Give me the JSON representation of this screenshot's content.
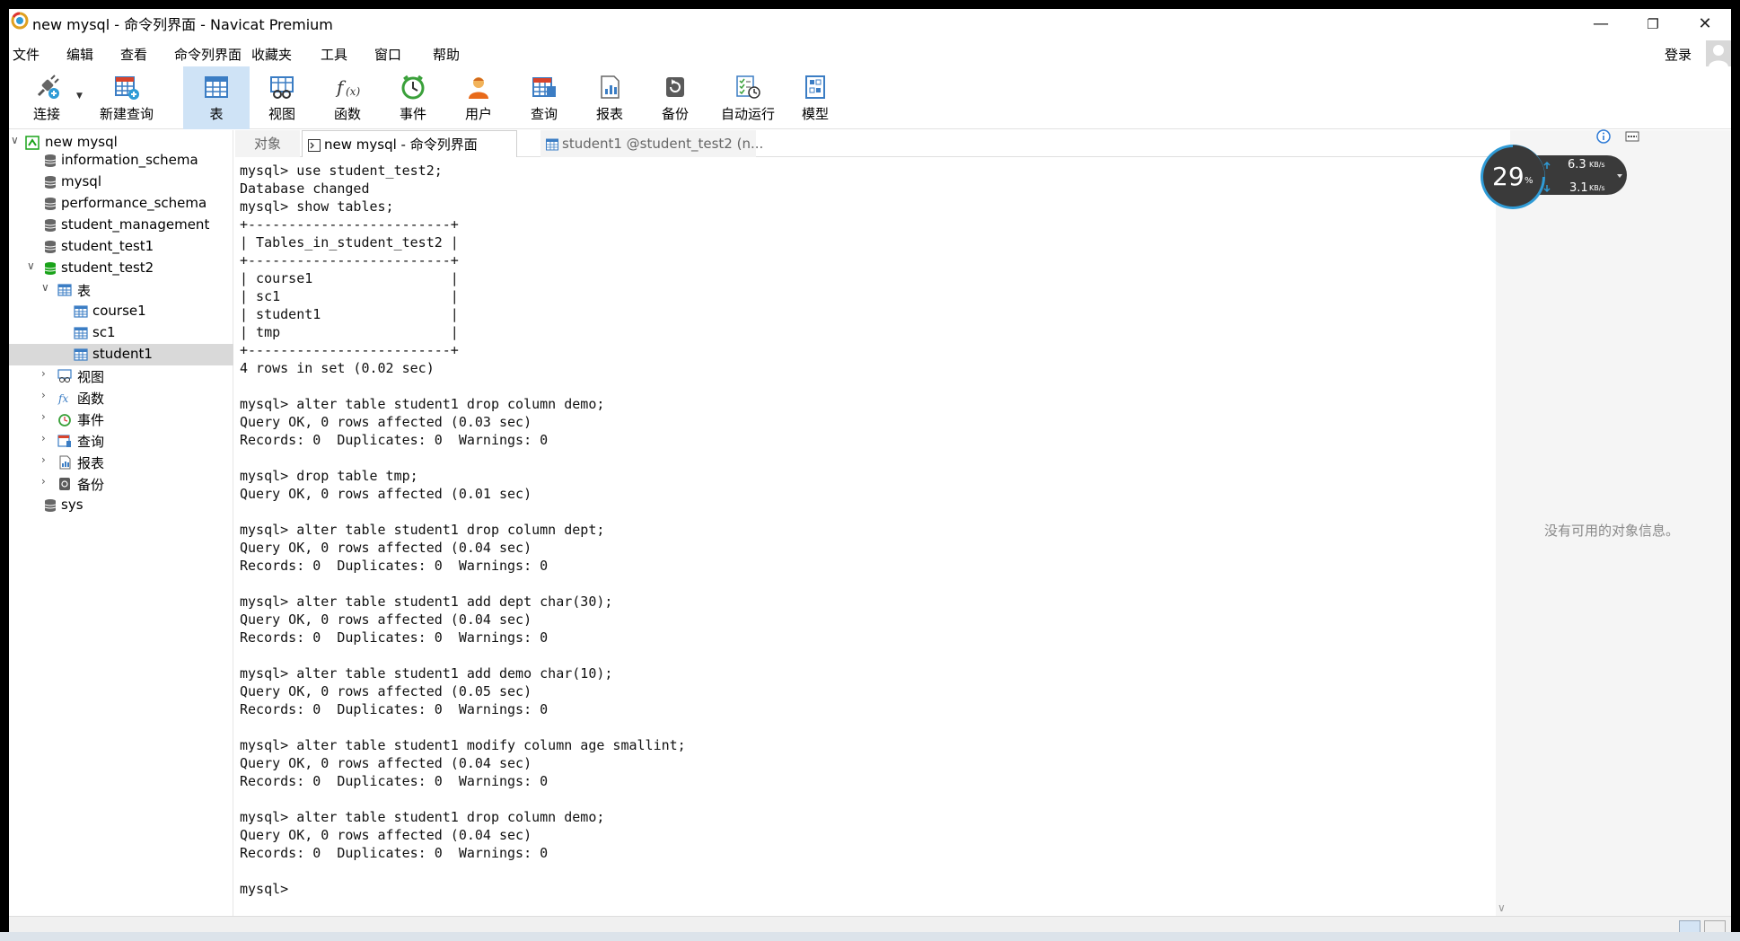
{
  "window": {
    "title": "new mysql - 命令列界面 - Navicat Premium",
    "minimize": "—",
    "restore": "❐",
    "close": "✕"
  },
  "menu": {
    "items": [
      "文件",
      "编辑",
      "查看",
      "命令列界面",
      "收藏夹",
      "工具",
      "窗口",
      "帮助"
    ],
    "login": "登录"
  },
  "toolbar": {
    "buttons": [
      {
        "label": "连接",
        "icon": "connection-icon"
      },
      {
        "label": "新建查询",
        "icon": "new-query-icon"
      },
      {
        "label": "表",
        "icon": "table-icon"
      },
      {
        "label": "视图",
        "icon": "view-icon"
      },
      {
        "label": "函数",
        "icon": "function-icon"
      },
      {
        "label": "事件",
        "icon": "event-icon"
      },
      {
        "label": "用户",
        "icon": "user-icon"
      },
      {
        "label": "查询",
        "icon": "query-icon"
      },
      {
        "label": "报表",
        "icon": "report-icon"
      },
      {
        "label": "备份",
        "icon": "backup-icon"
      },
      {
        "label": "自动运行",
        "icon": "automation-icon"
      },
      {
        "label": "模型",
        "icon": "model-icon"
      }
    ]
  },
  "navigator": {
    "items": [
      {
        "label": "new mysql",
        "icon": "connection-icon",
        "level": 0,
        "expanded": true
      },
      {
        "label": "information_schema",
        "icon": "database-icon",
        "level": 1
      },
      {
        "label": "mysql",
        "icon": "database-icon",
        "level": 1
      },
      {
        "label": "performance_schema",
        "icon": "database-icon",
        "level": 1
      },
      {
        "label": "student_management",
        "icon": "database-icon",
        "level": 1
      },
      {
        "label": "student_test1",
        "icon": "database-icon",
        "level": 1
      },
      {
        "label": "student_test2",
        "icon": "database-open-icon",
        "level": 1,
        "expanded": true
      },
      {
        "label": "表",
        "icon": "table-icon",
        "level": 2,
        "expanded": true
      },
      {
        "label": "course1",
        "icon": "table-icon",
        "level": 3
      },
      {
        "label": "sc1",
        "icon": "table-icon",
        "level": 3
      },
      {
        "label": "student1",
        "icon": "table-icon",
        "level": 3,
        "selected": true
      },
      {
        "label": "视图",
        "icon": "view-icon",
        "level": 2,
        "collapsed": true
      },
      {
        "label": "函数",
        "icon": "function-icon",
        "level": 2,
        "collapsed": true
      },
      {
        "label": "事件",
        "icon": "event-icon",
        "level": 2,
        "collapsed": true
      },
      {
        "label": "查询",
        "icon": "query-icon",
        "level": 2,
        "collapsed": true
      },
      {
        "label": "报表",
        "icon": "report-icon",
        "level": 2,
        "collapsed": true
      },
      {
        "label": "备份",
        "icon": "backup-icon",
        "level": 2,
        "collapsed": true
      },
      {
        "label": "sys",
        "icon": "database-icon",
        "level": 1
      }
    ]
  },
  "tabs": [
    {
      "label": "对象",
      "state": "inactive"
    },
    {
      "label": "new mysql - 命令列界面",
      "state": "active"
    },
    {
      "label": "student1 @student_test2 (n...",
      "state": "inactive"
    }
  ],
  "console": {
    "text": "mysql> use student_test2;\nDatabase changed\nmysql> show tables;\n+-------------------------+\n| Tables_in_student_test2 |\n+-------------------------+\n| course1                 |\n| sc1                     |\n| student1                |\n| tmp                     |\n+-------------------------+\n4 rows in set (0.02 sec)\n\nmysql> alter table student1 drop column demo;\nQuery OK, 0 rows affected (0.03 sec)\nRecords: 0  Duplicates: 0  Warnings: 0\n\nmysql> drop table tmp;\nQuery OK, 0 rows affected (0.01 sec)\n\nmysql> alter table student1 drop column dept;\nQuery OK, 0 rows affected (0.04 sec)\nRecords: 0  Duplicates: 0  Warnings: 0\n\nmysql> alter table student1 add dept char(30);\nQuery OK, 0 rows affected (0.04 sec)\nRecords: 0  Duplicates: 0  Warnings: 0\n\nmysql> alter table student1 add demo char(10);\nQuery OK, 0 rows affected (0.05 sec)\nRecords: 0  Duplicates: 0  Warnings: 0\n\nmysql> alter table student1 modify column age smallint;\nQuery OK, 0 rows affected (0.04 sec)\nRecords: 0  Duplicates: 0  Warnings: 0\n\nmysql> alter table student1 drop column demo;\nQuery OK, 0 rows affected (0.04 sec)\nRecords: 0  Duplicates: 0  Warnings: 0\n\nmysql> "
  },
  "info_panel": {
    "message": "没有可用的对象信息。"
  },
  "net_widget": {
    "percent": "29",
    "percent_unit": "%",
    "upload": "6.3",
    "download": "3.1",
    "unit": "KB/s"
  },
  "colors": {
    "accent": "#cfe3f6",
    "selection": "#d9d9d9",
    "db_green": "#1aa31a",
    "widget_bg": "#3a3a3a",
    "widget_ring": "#2f9bd6"
  }
}
